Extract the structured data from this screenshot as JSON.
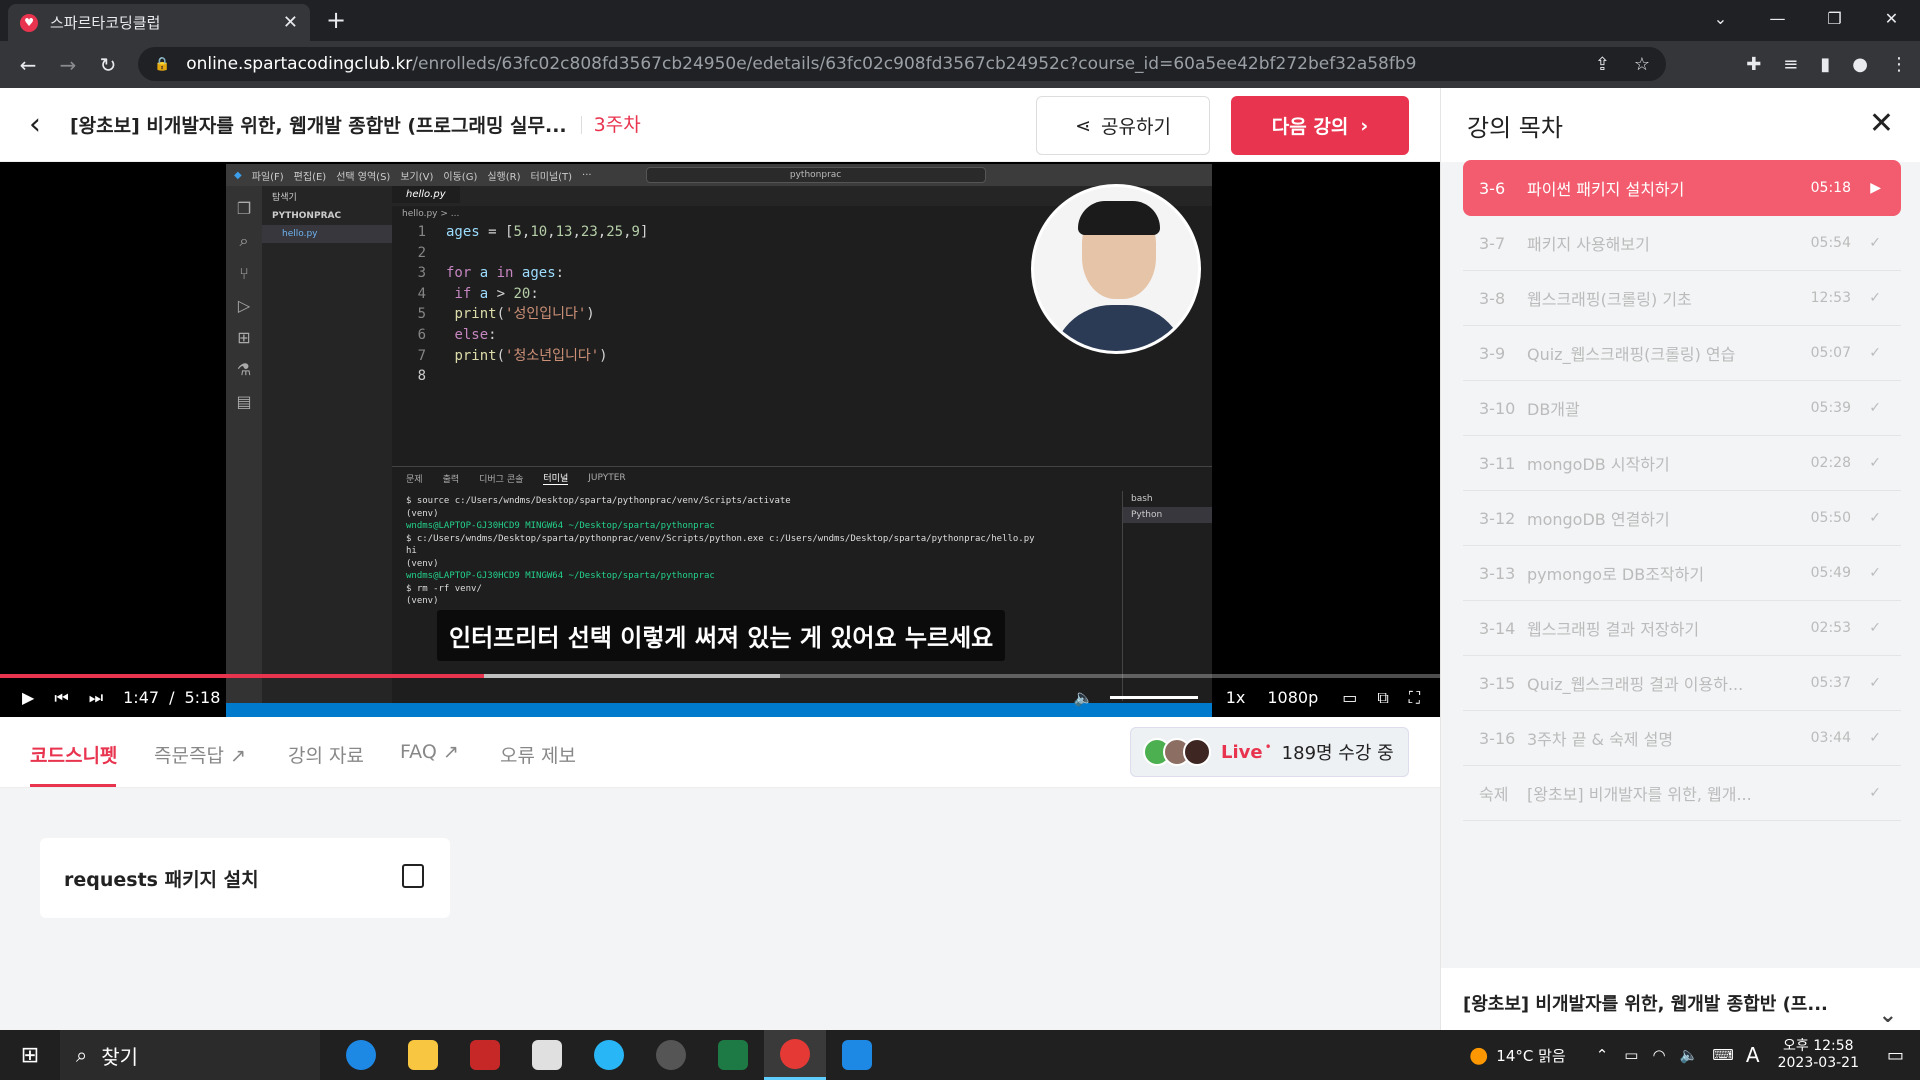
{
  "browser": {
    "tab_title": "스파르타코딩클럽",
    "url_domain": "online.spartacodingclub.kr",
    "url_path": "/enrolleds/63fc02c808fd3567cb24950e/edetails/63fc02c908fd3567cb24952c?course_id=60a5ee42bf272bef32a58fb9"
  },
  "header": {
    "course_title": "[왕초보] 비개발자를 위한, 웹개발 종합반 (프로그래밍 실무...",
    "week": "3주차",
    "share_label": "공유하기",
    "next_label": "다음 강의"
  },
  "video": {
    "vscode_menu": [
      "파일(F)",
      "편집(E)",
      "선택 영역(S)",
      "보기(V)",
      "이동(G)",
      "실행(R)",
      "터미널(T)",
      "···"
    ],
    "vscode_search": "pythonprac",
    "explorer_title": "탐색기",
    "project": "PYTHONPRAC",
    "file": "hello.py",
    "breadcrumb": "hello.py > ...",
    "terminal_tabs": [
      "문제",
      "출력",
      "디버그 콘솔",
      "터미널",
      "JUPYTER"
    ],
    "term_lines": [
      "$ source c:/Users/wndms/Desktop/sparta/pythonprac/venv/Scripts/activate",
      "(venv)",
      "wndms@LAPTOP-GJ30HCD9 MINGW64 ~/Desktop/sparta/pythonprac",
      "$ c:/Users/wndms/Desktop/sparta/pythonprac/venv/Scripts/python.exe c:/Users/wndms/Desktop/sparta/pythonprac/hello.py",
      "hi",
      "(venv)",
      "wndms@LAPTOP-GJ30HCD9 MINGW64 ~/Desktop/sparta/pythonprac",
      "$ rm -rf venv/",
      "(venv)"
    ],
    "term_side": [
      "bash",
      "Python"
    ],
    "subtitle": "인터프리터 선택 이렇게 써져 있는 게 있어요 누르세요",
    "current_time": "1:47",
    "duration": "5:18",
    "played_fraction": 0.336,
    "loaded_fraction": 0.542,
    "speed": "1x",
    "quality": "1080p"
  },
  "tabs": [
    "코드스니펫",
    "즉문즉답",
    "강의 자료",
    "FAQ",
    "오류 제보"
  ],
  "live": {
    "label": "Live",
    "viewers": "189명 수강 중"
  },
  "snippet": {
    "title": "requests 패키지 설치"
  },
  "sidebar": {
    "title": "강의 목차",
    "items": [
      {
        "no": "3-6",
        "title": "파이썬 패키지 설치하기",
        "time": "05:18"
      },
      {
        "no": "3-7",
        "title": "패키지 사용해보기",
        "time": "05:54"
      },
      {
        "no": "3-8",
        "title": "웹스크래핑(크롤링) 기초",
        "time": "12:53"
      },
      {
        "no": "3-9",
        "title": "Quiz_웹스크래핑(크롤링) 연습",
        "time": "05:07"
      },
      {
        "no": "3-10",
        "title": "DB개괄",
        "time": "05:39"
      },
      {
        "no": "3-11",
        "title": "mongoDB 시작하기",
        "time": "02:28"
      },
      {
        "no": "3-12",
        "title": "mongoDB 연결하기",
        "time": "05:50"
      },
      {
        "no": "3-13",
        "title": "pymongo로 DB조작하기",
        "time": "05:49"
      },
      {
        "no": "3-14",
        "title": "웹스크래핑 결과 저장하기",
        "time": "02:53"
      },
      {
        "no": "3-15",
        "title": "Quiz_웹스크래핑 결과 이용하...",
        "time": "05:37"
      },
      {
        "no": "3-16",
        "title": "3주차 끝 & 숙제 설명",
        "time": "03:44"
      },
      {
        "no": "숙제",
        "title": "[왕초보] 비개발자를 위한, 웹개...",
        "time": ""
      }
    ],
    "footer": "[왕초보] 비개발자를 위한, 웹개발 종합반 (프..."
  },
  "taskbar": {
    "search": "찾기",
    "weather": "14°C  맑음",
    "ime": "A",
    "ampm": "오후 12:58",
    "date": "2023-03-21"
  }
}
